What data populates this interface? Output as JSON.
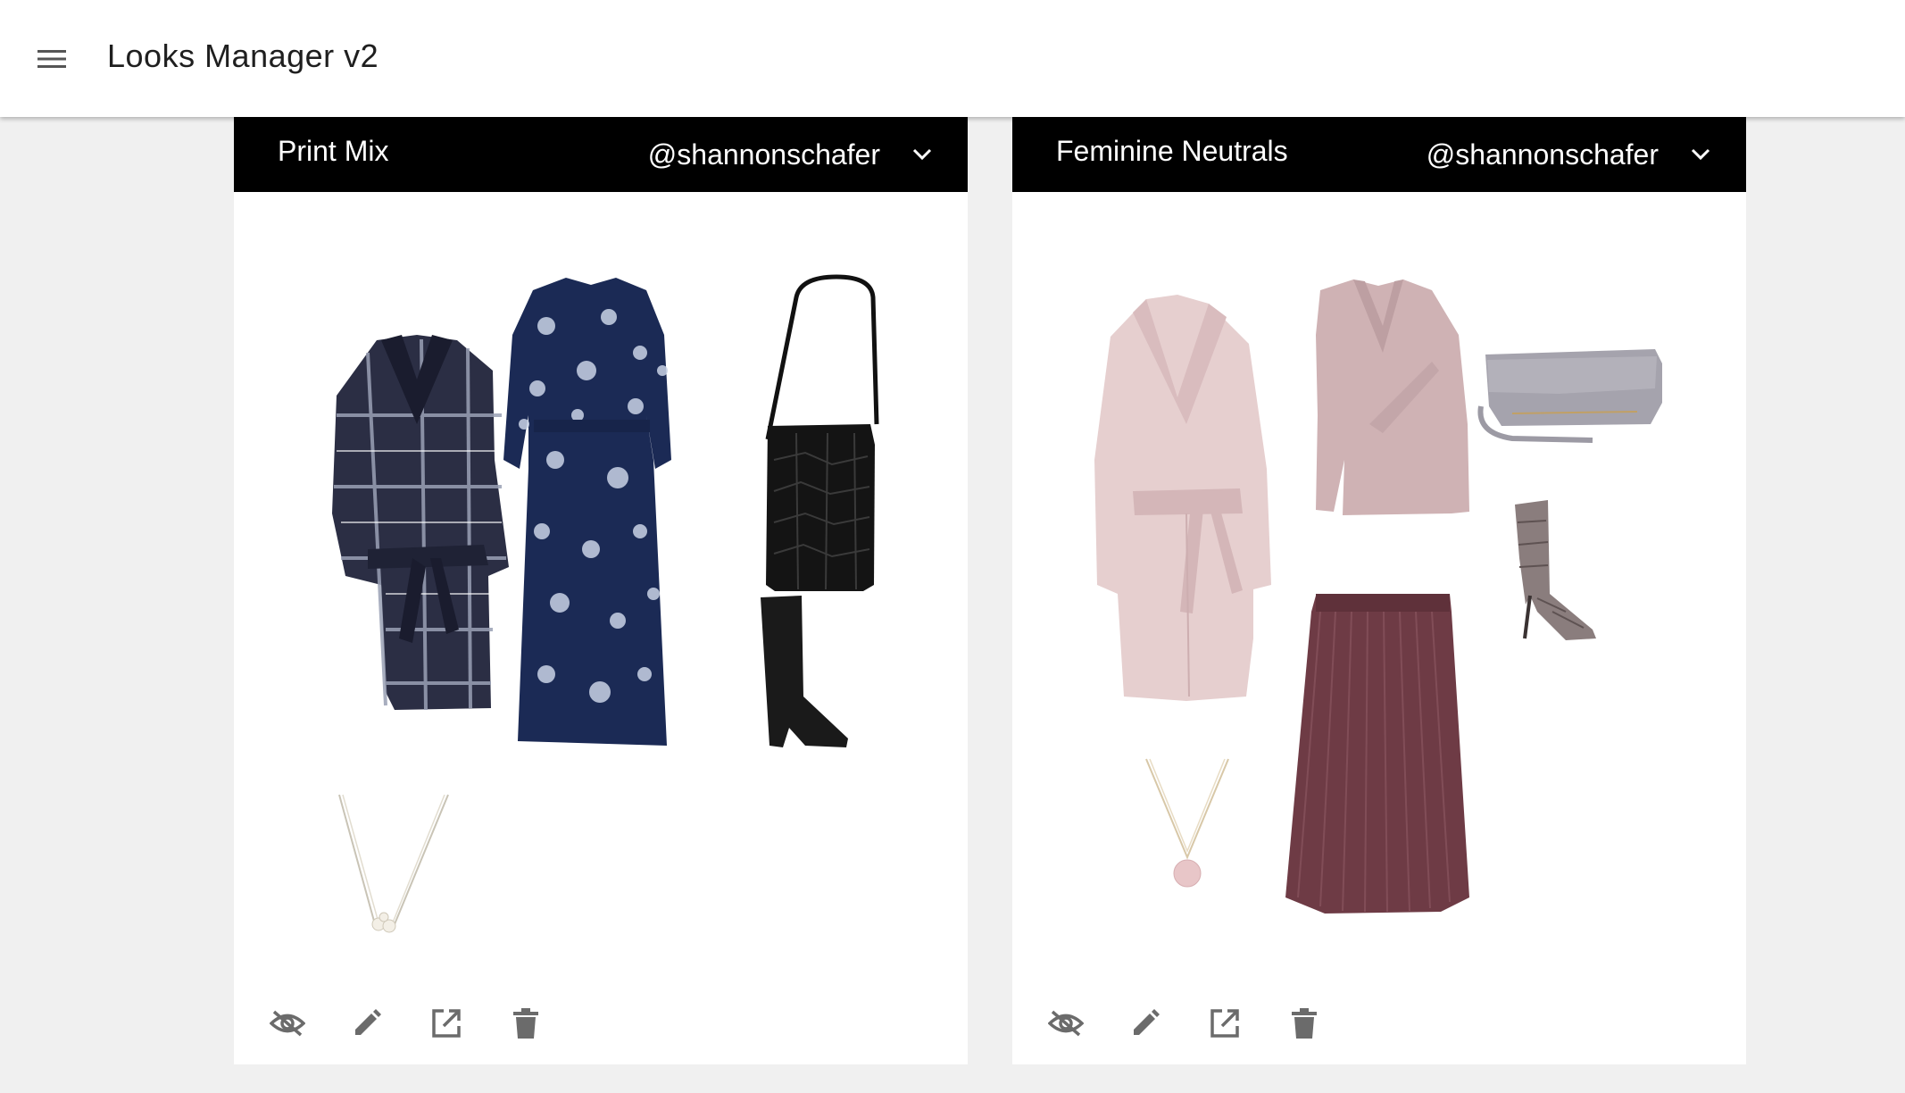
{
  "app": {
    "title": "Looks Manager v2",
    "menu_icon": "menu-icon"
  },
  "looks": [
    {
      "title": "Print Mix",
      "user": "@shannonschafer",
      "items": [
        "plaid-wrap-coat",
        "floral-midi-dress",
        "croc-tote-bag",
        "black-knee-boots",
        "pearl-pendant-necklace"
      ],
      "actions": [
        "visibility-off-icon",
        "edit-icon",
        "open-in-new-icon",
        "delete-icon"
      ]
    },
    {
      "title": "Feminine Neutrals",
      "user": "@shannonschafer",
      "items": [
        "blush-wrap-coat",
        "pink-wrap-sweater",
        "grey-crossbody-bag",
        "snakeskin-ankle-boots",
        "burgundy-pleated-skirt",
        "rose-quartz-necklace"
      ],
      "actions": [
        "visibility-off-icon",
        "edit-icon",
        "open-in-new-icon",
        "delete-icon"
      ]
    }
  ],
  "colors": {
    "header_bg": "#000000",
    "page_bg": "#f0f0f0",
    "card_bg": "#ffffff",
    "icon_grey": "#6b6b6b"
  }
}
